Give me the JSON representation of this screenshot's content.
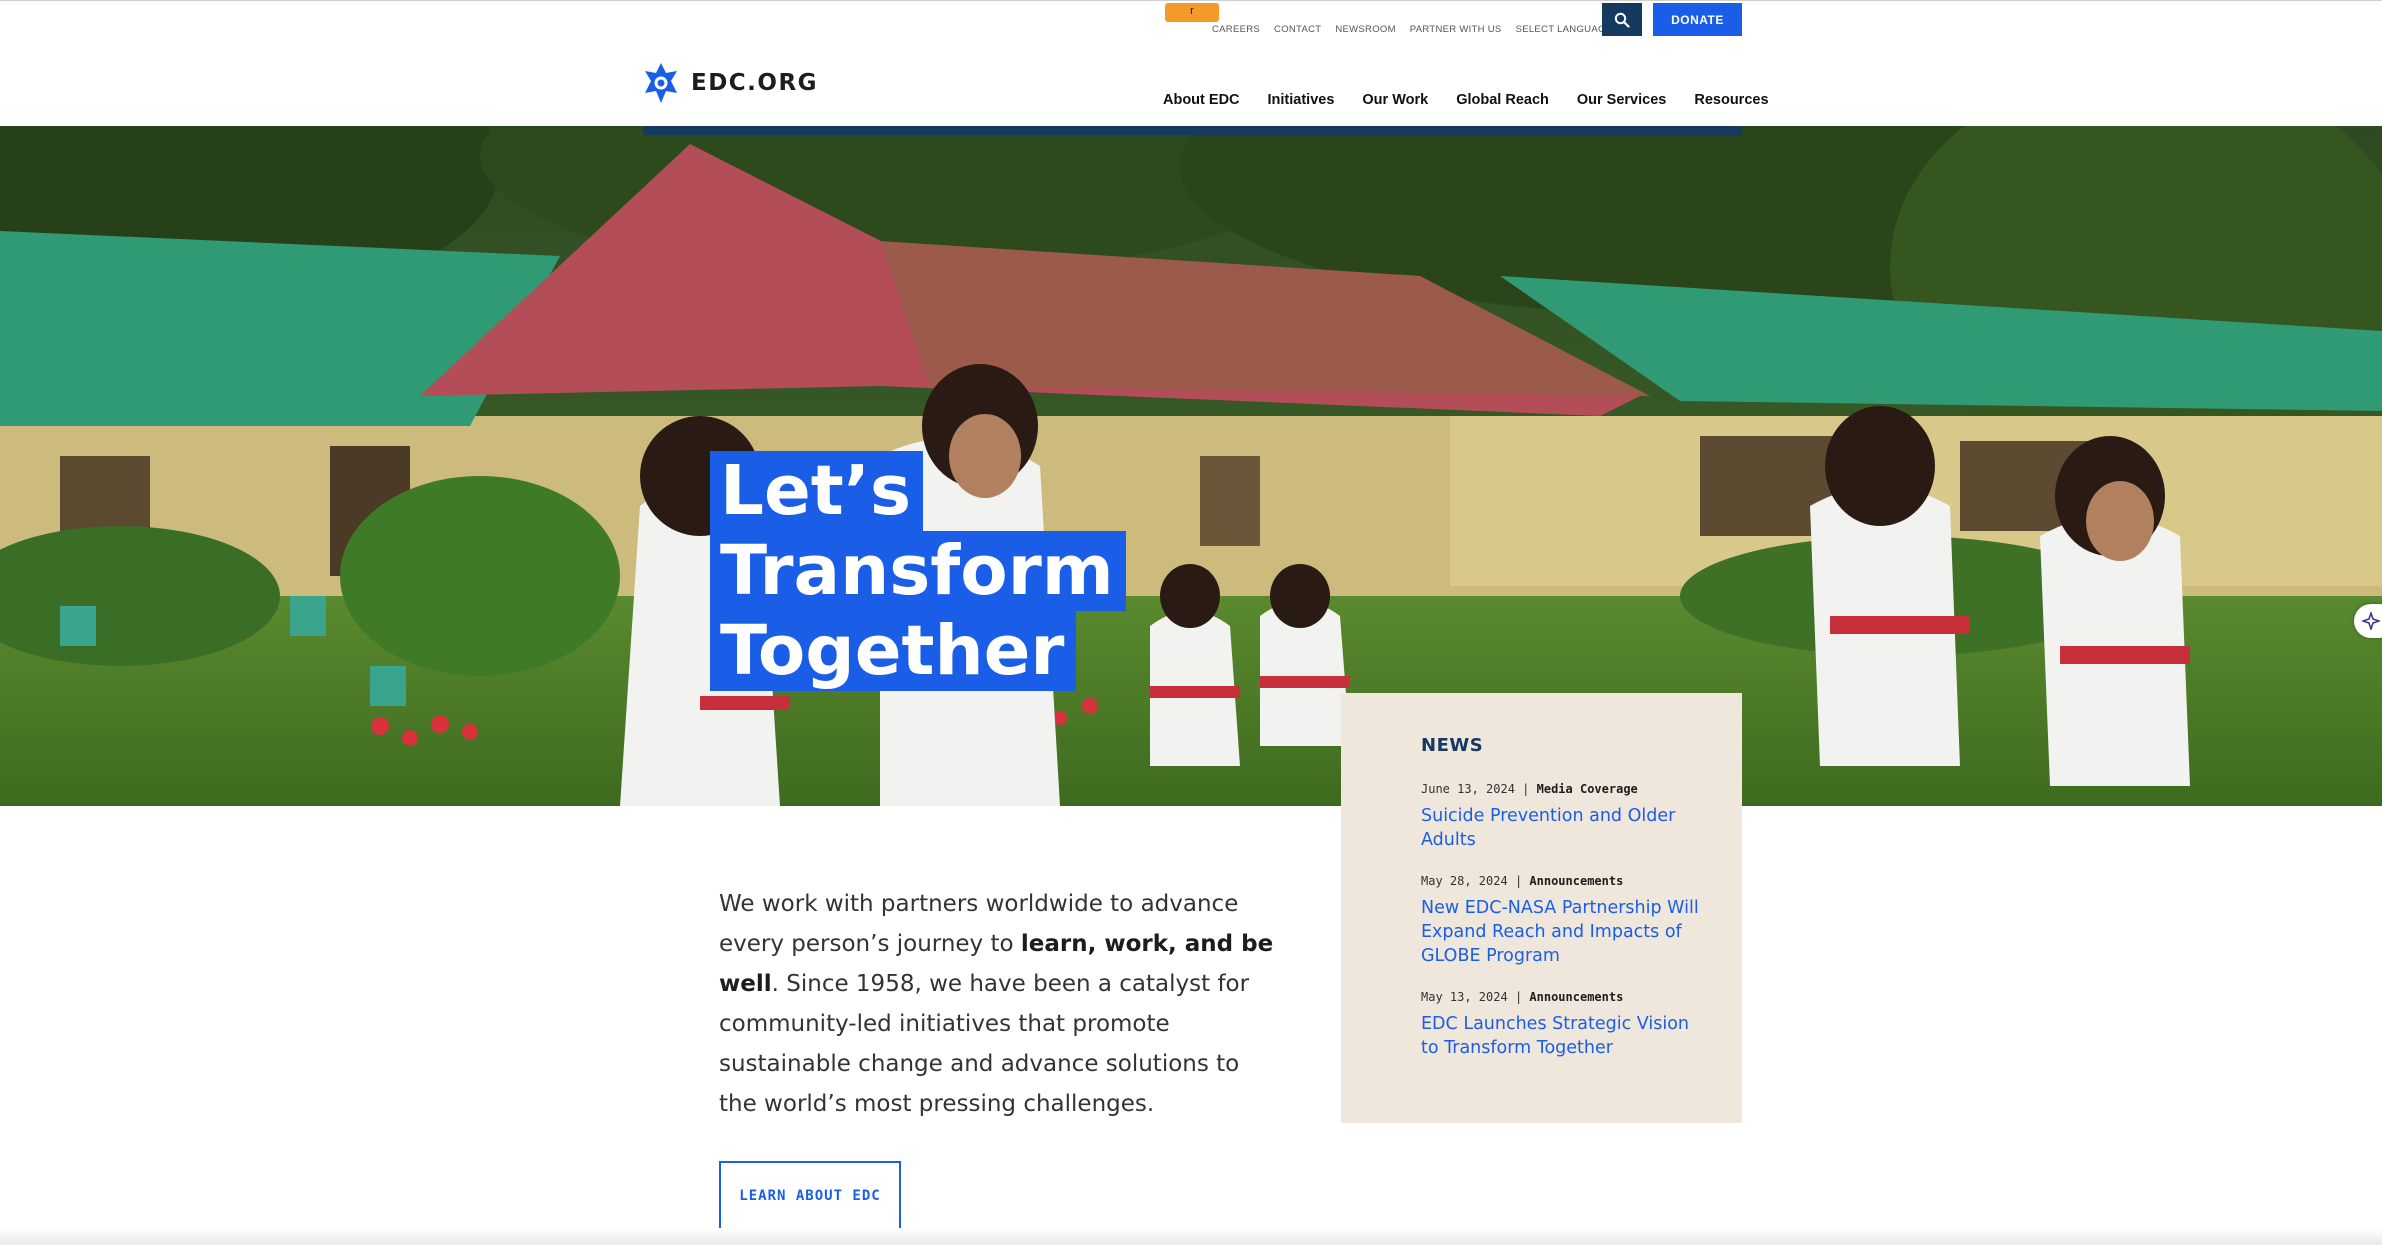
{
  "header": {
    "utility_tab_label": "r",
    "utility_links": [
      "CAREERS",
      "CONTACT",
      "NEWSROOM",
      "PARTNER WITH US"
    ],
    "language_select": "SELECT LANGUAGE",
    "donate_label": "DONATE",
    "logo_text": "EDC.ORG",
    "nav": [
      "About EDC",
      "Initiatives",
      "Our Work",
      "Global Reach",
      "Our Services",
      "Resources"
    ]
  },
  "hero": {
    "headline": [
      "Let’s",
      "Transform",
      "Together"
    ]
  },
  "intro": {
    "text_before": "We work with partners worldwide to advance every person’s journey to ",
    "text_bold": "learn, work, and be well",
    "text_after": ". Since 1958, we have been a catalyst for community-led initiatives that promote sustainable change and advance solutions to the world’s most pressing challenges.",
    "button_label": "LEARN ABOUT EDC"
  },
  "news": {
    "title": "NEWS",
    "items": [
      {
        "date": "June 13, 2024",
        "separator": "|",
        "category": "Media Coverage",
        "headline": "Suicide Prevention and Older Adults"
      },
      {
        "date": "May 28, 2024",
        "separator": "|",
        "category": "Announcements",
        "headline": "New EDC-NASA Partnership Will Expand Reach and Impacts of GLOBE Program"
      },
      {
        "date": "May 13, 2024",
        "separator": "|",
        "category": "Announcements",
        "headline": "EDC Launches Strategic Vision to Transform Together"
      }
    ]
  },
  "colors": {
    "brand_blue": "#1a5ee8",
    "navy": "#143a60",
    "donate_orange": "#f39a2b",
    "news_bg": "#efe6dc"
  },
  "icons": [
    "search-icon",
    "edc-star-logo-icon",
    "chevron-down-icon",
    "sparkle-icon"
  ]
}
